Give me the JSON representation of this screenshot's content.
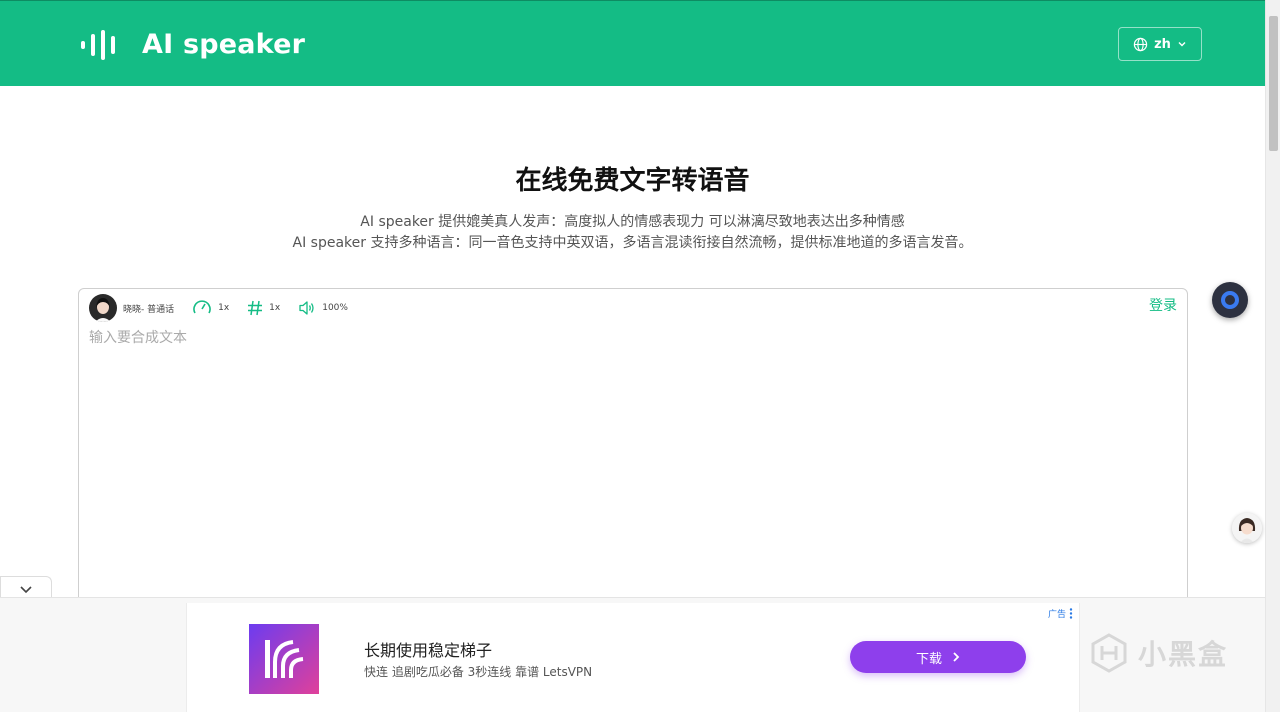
{
  "header": {
    "app_name": "AI speaker",
    "language": "zh",
    "brand_color": "#14bc85"
  },
  "hero": {
    "title": "在线免费文字转语音",
    "subtitle_line1": "AI speaker 提供媲美真人发声：高度拟人的情感表现力 可以淋漓尽致地表达出多种情感",
    "subtitle_line2": "AI speaker 支持多种语言：同一音色支持中英双语，多语言混读衔接自然流畅，提供标准地道的多语言发音。"
  },
  "editor": {
    "voice_name": "晓晓- 普通话",
    "speed": "1x",
    "pitch": "1x",
    "volume": "100%",
    "login_label": "登录",
    "placeholder": "输入要合成文本",
    "text_value": ""
  },
  "ad": {
    "label": "广告",
    "title": "长期使用稳定梯子",
    "description": "快连 追剧吃瓜必备 3秒连线 靠谱 LetsVPN",
    "button_label": "下载",
    "button_color": "#8e3fec"
  },
  "watermark": {
    "text": "小黑盒"
  }
}
